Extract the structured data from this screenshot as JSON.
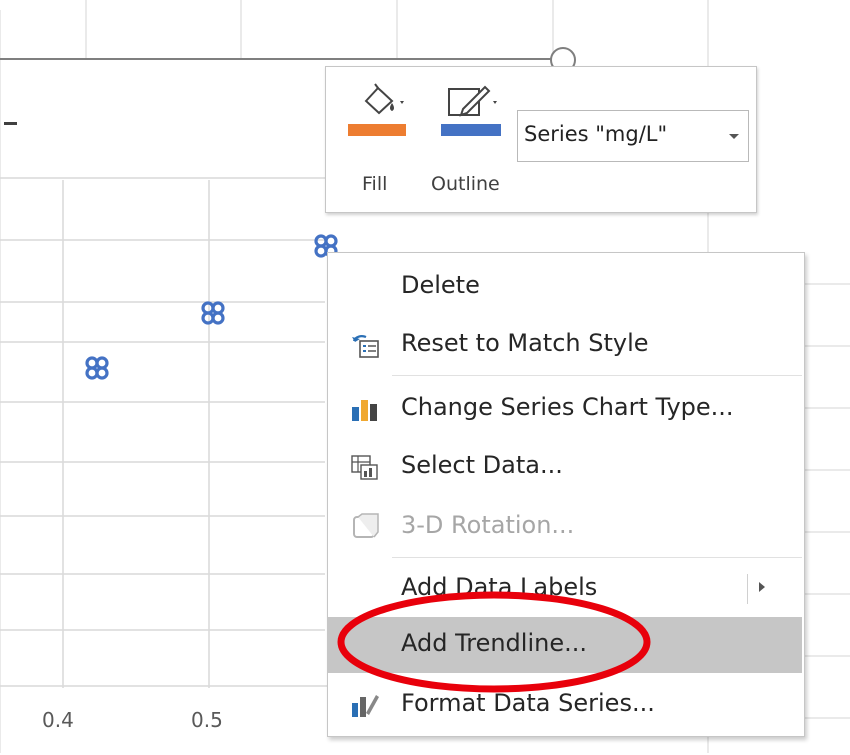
{
  "chart": {
    "x_ticks": [
      "0.4",
      "0.5"
    ],
    "marker_color": "#4472c4"
  },
  "mini_toolbar": {
    "fill_label": "Fill",
    "outline_label": "Outline",
    "fill_color": "#ed7d31",
    "outline_color": "#4472c4",
    "series_selected": "Series \"mg/L\""
  },
  "context_menu": {
    "items": [
      {
        "label": "Delete",
        "icon": "none",
        "enabled": true
      },
      {
        "label": "Reset to Match Style",
        "icon": "reset-style-icon",
        "enabled": true
      },
      {
        "label": "Change Series Chart Type...",
        "icon": "bar-chart-icon",
        "enabled": true
      },
      {
        "label": "Select Data...",
        "icon": "select-data-icon",
        "enabled": true
      },
      {
        "label": "3-D Rotation...",
        "icon": "rotation-3d-icon",
        "enabled": false
      },
      {
        "label": "Add Data Labels",
        "icon": "none",
        "enabled": true,
        "submenu": true
      },
      {
        "label": "Add Trendline...",
        "icon": "none",
        "enabled": true,
        "highlighted": true
      },
      {
        "label": "Format Data Series...",
        "icon": "format-series-icon",
        "enabled": true
      }
    ]
  },
  "annotation": {
    "circle_color": "#e8000b"
  }
}
